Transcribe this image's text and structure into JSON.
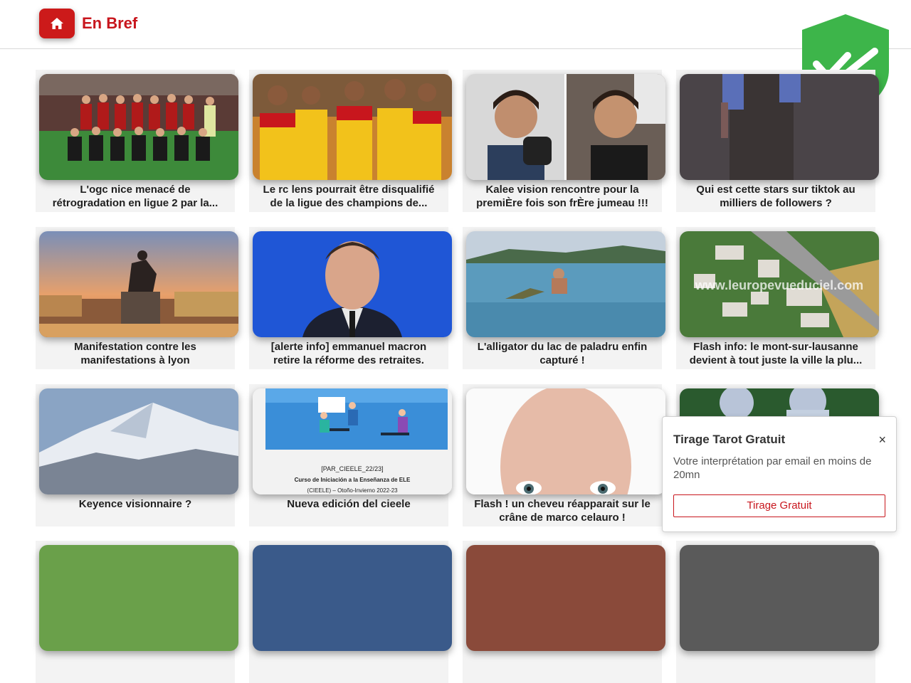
{
  "header": {
    "brand": "En Bref",
    "accent_color": "#c8161d",
    "home_icon": "home-icon"
  },
  "badge": {
    "icon": "shield-check-icon",
    "color": "#3db54a"
  },
  "articles": [
    {
      "title": "L'ogc nice menacé de rétrogradation en ligue 2 par la...",
      "image": "football-team-photo"
    },
    {
      "title": "Le rc lens pourrait être disqualifié de la ligue des champions de...",
      "image": "football-players-celebrating"
    },
    {
      "title": "Kalee vision rencontre pour la premiÈre fois son frÈre jumeau !!!",
      "image": "two-men-streaming"
    },
    {
      "title": "Qui est cette stars sur tiktok au milliers de followers ?",
      "image": "person-standing"
    },
    {
      "title": "Manifestation contre les manifestations à lyon",
      "image": "lyon-statue-sunset"
    },
    {
      "title": "[alerte info] emmanuel macron retire la réforme des retraites.",
      "image": "man-in-suit-portrait"
    },
    {
      "title": "L'alligator du lac de paladru enfin capturé !",
      "image": "lake-alligator"
    },
    {
      "title": "Flash info: le mont-sur-lausanne devient à tout juste la ville la plu...",
      "image": "aerial-town-view"
    },
    {
      "title": "Keyence visionnaire ?",
      "image": "snowy-mountain"
    },
    {
      "title": "Nueva edición del cieele",
      "image": "course-poster"
    },
    {
      "title": "Flash ! un cheveu réapparait sur le crâne de marco celauro !",
      "image": "bald-man-face"
    },
    {
      "title": "",
      "image": "football-match"
    }
  ],
  "poster_text": {
    "line1": "[PAR_CIEELE_22/23]",
    "line2": "Curso de Iniciación a la Enseñanza de  ELE",
    "line3": "(CIEELE) – Otoño-Invierno 2022-23"
  },
  "watermark": "www.leuropevueduciel.com",
  "popup": {
    "title": "Tirage Tarot Gratuit",
    "close": "×",
    "text": "Votre interprétation par email en moins de 20mn",
    "button": "Tirage Gratuit"
  }
}
